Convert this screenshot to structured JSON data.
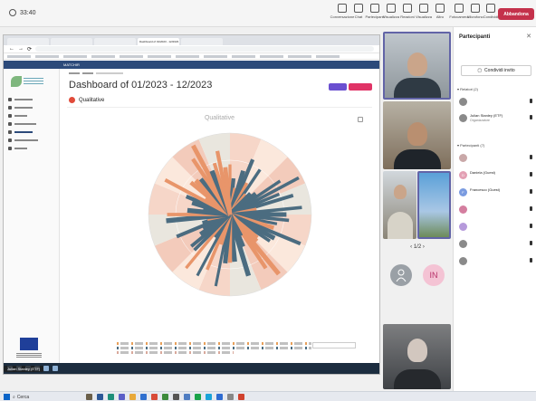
{
  "meeting": {
    "timer": "33:40",
    "toolbar": [
      "Conversazione",
      "Chat",
      "Partecipanti",
      "Visualizza",
      "Reazioni",
      "Visualizza",
      "Altro",
      "Fotocamera",
      "Microfono",
      "Condividi"
    ],
    "leave_label": "Abbandona"
  },
  "browser": {
    "tabs": [
      "",
      "",
      "",
      "Dashboard of 01/2023 - 12/2023",
      ""
    ],
    "app_header": "MATCHIR"
  },
  "dashboard": {
    "title": "Dashboard of 01/2023 - 12/2023",
    "section": "Qualitative",
    "chart_title": "Qualitative"
  },
  "chart_data": {
    "type": "bar",
    "subtype": "polar-bar",
    "title": "Qualitative",
    "note": "Radial bars of varying length arranged around a circle; individual values are not legible in the screenshot.",
    "colors": [
      "#4b6c80",
      "#e8956a",
      "#e7b79b",
      "#f3d1c2"
    ]
  },
  "shared_screen_name": "Julian Stanley (ETF)",
  "grid": {
    "pager": "1/2",
    "tiles": [
      {
        "name": "",
        "color": "#9aa0a6",
        "letter": ""
      },
      {
        "name": "",
        "color": "#f4c3d4",
        "letter": "IN"
      }
    ]
  },
  "panel": {
    "title": "Partecipanti",
    "invite": "Condividi invito",
    "organizers_header": "Relatori (2)",
    "attendees_header": "Partecipanti (7)",
    "organizers": [
      {
        "name": "",
        "role": "",
        "initial": "",
        "color": "#8a8a8a"
      },
      {
        "name": "Julian Stanley (ETF)",
        "role": "Organizzatore",
        "initial": "",
        "color": "#8a8a8a"
      }
    ],
    "attendees": [
      {
        "name": "",
        "role": "",
        "initial": "",
        "color": "#c9a8a8"
      },
      {
        "name": "Daniela (Guest)",
        "role": "",
        "initial": "D",
        "color": "#e3a0b4"
      },
      {
        "name": "Francesco (Guest)",
        "role": "",
        "initial": "F",
        "color": "#7a9be0"
      },
      {
        "name": "",
        "role": "",
        "initial": "",
        "color": "#d47e9f"
      },
      {
        "name": "",
        "role": "",
        "initial": "",
        "color": "#b69adb"
      },
      {
        "name": "",
        "role": "",
        "initial": "",
        "color": "#8a8a8a"
      },
      {
        "name": "",
        "role": "",
        "initial": "",
        "color": "#8a8a8a"
      }
    ]
  },
  "taskbar": {
    "search_label": "Cerca",
    "weather": "",
    "time": "",
    "date": ""
  }
}
